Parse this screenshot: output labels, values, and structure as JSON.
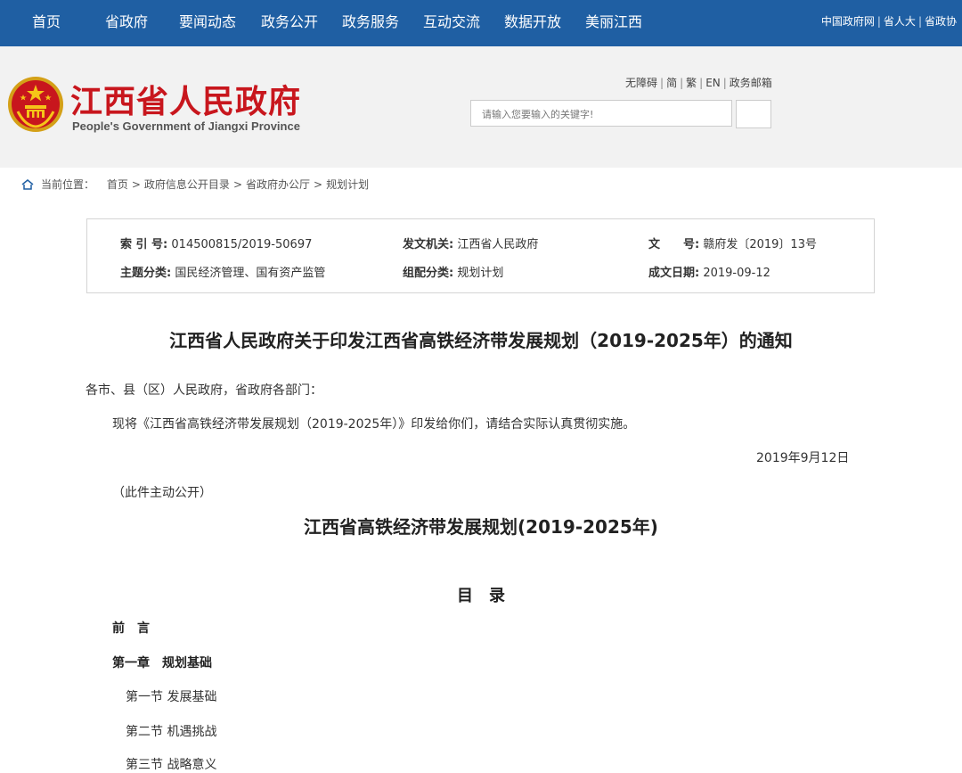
{
  "nav": {
    "items": [
      "首页",
      "省政府",
      "要闻动态",
      "政务公开",
      "政务服务",
      "互动交流",
      "数据开放",
      "美丽江西"
    ],
    "right_links": [
      "中国政府网",
      "省人大",
      "省政协"
    ]
  },
  "header": {
    "site_title": "江西省人民政府",
    "site_subtitle": "People's Government of Jiangxi Province",
    "util_links": [
      "无障碍",
      "简",
      "繁",
      "EN",
      "政务邮箱"
    ],
    "search_placeholder": "请输入您要输入的关键字!"
  },
  "breadcrumb": {
    "label": "当前位置：",
    "items": [
      "首页",
      "政府信息公开目录",
      "省政府办公厅",
      "规划计划"
    ]
  },
  "meta": {
    "index_label": "索 引 号:",
    "index_value": "014500815/2019-50697",
    "issuer_label": "发文机关:",
    "issuer_value": "江西省人民政府",
    "docno_label": "文　　号:",
    "docno_value": "赣府发〔2019〕13号",
    "topic_label": "主题分类:",
    "topic_value": "国民经济管理、国有资产监管",
    "category_label": "组配分类:",
    "category_value": "规划计划",
    "date_label": "成文日期:",
    "date_value": "2019-09-12"
  },
  "article": {
    "title": "江西省人民政府关于印发江西省高铁经济带发展规划（2019-2025年）的通知",
    "salutation": "各市、县（区）人民政府，省政府各部门：",
    "body": "现将《江西省高铁经济带发展规划（2019-2025年）》印发给你们，请结合实际认真贯彻实施。",
    "date": "2019年9月12日",
    "note": "（此件主动公开）",
    "plan_title": "江西省高铁经济带发展规划(2019-2025年)",
    "toc_title": "目　录",
    "toc": {
      "preface": "前　言",
      "chapter1": "第一章　规划基础",
      "sections": [
        "第一节  发展基础",
        "第二节  机遇挑战",
        "第三节  战略意义"
      ]
    }
  },
  "colors": {
    "nav_bg": "#1f5fa3",
    "title_red": "#c8161d",
    "header_bg": "#f2f2f2"
  }
}
